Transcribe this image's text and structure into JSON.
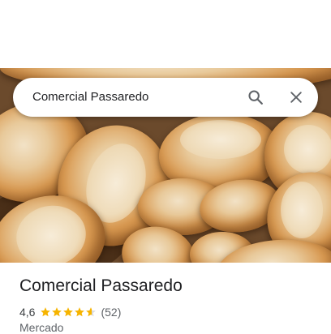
{
  "search": {
    "query": "Comercial Passaredo",
    "search_icon": "search-icon",
    "close_icon": "close-icon"
  },
  "hero_image": {
    "description_icon": "bread-photo"
  },
  "place": {
    "name": "Comercial Passaredo",
    "rating": "4,6",
    "rating_value": 4.6,
    "rating_max": 5,
    "review_count": "(52)",
    "category": "Mercado"
  },
  "colors": {
    "star": "#f6b400",
    "star_empty": "#dadce0",
    "text_primary": "#202124",
    "text_secondary": "#5f6368",
    "icon": "#5f6368"
  }
}
